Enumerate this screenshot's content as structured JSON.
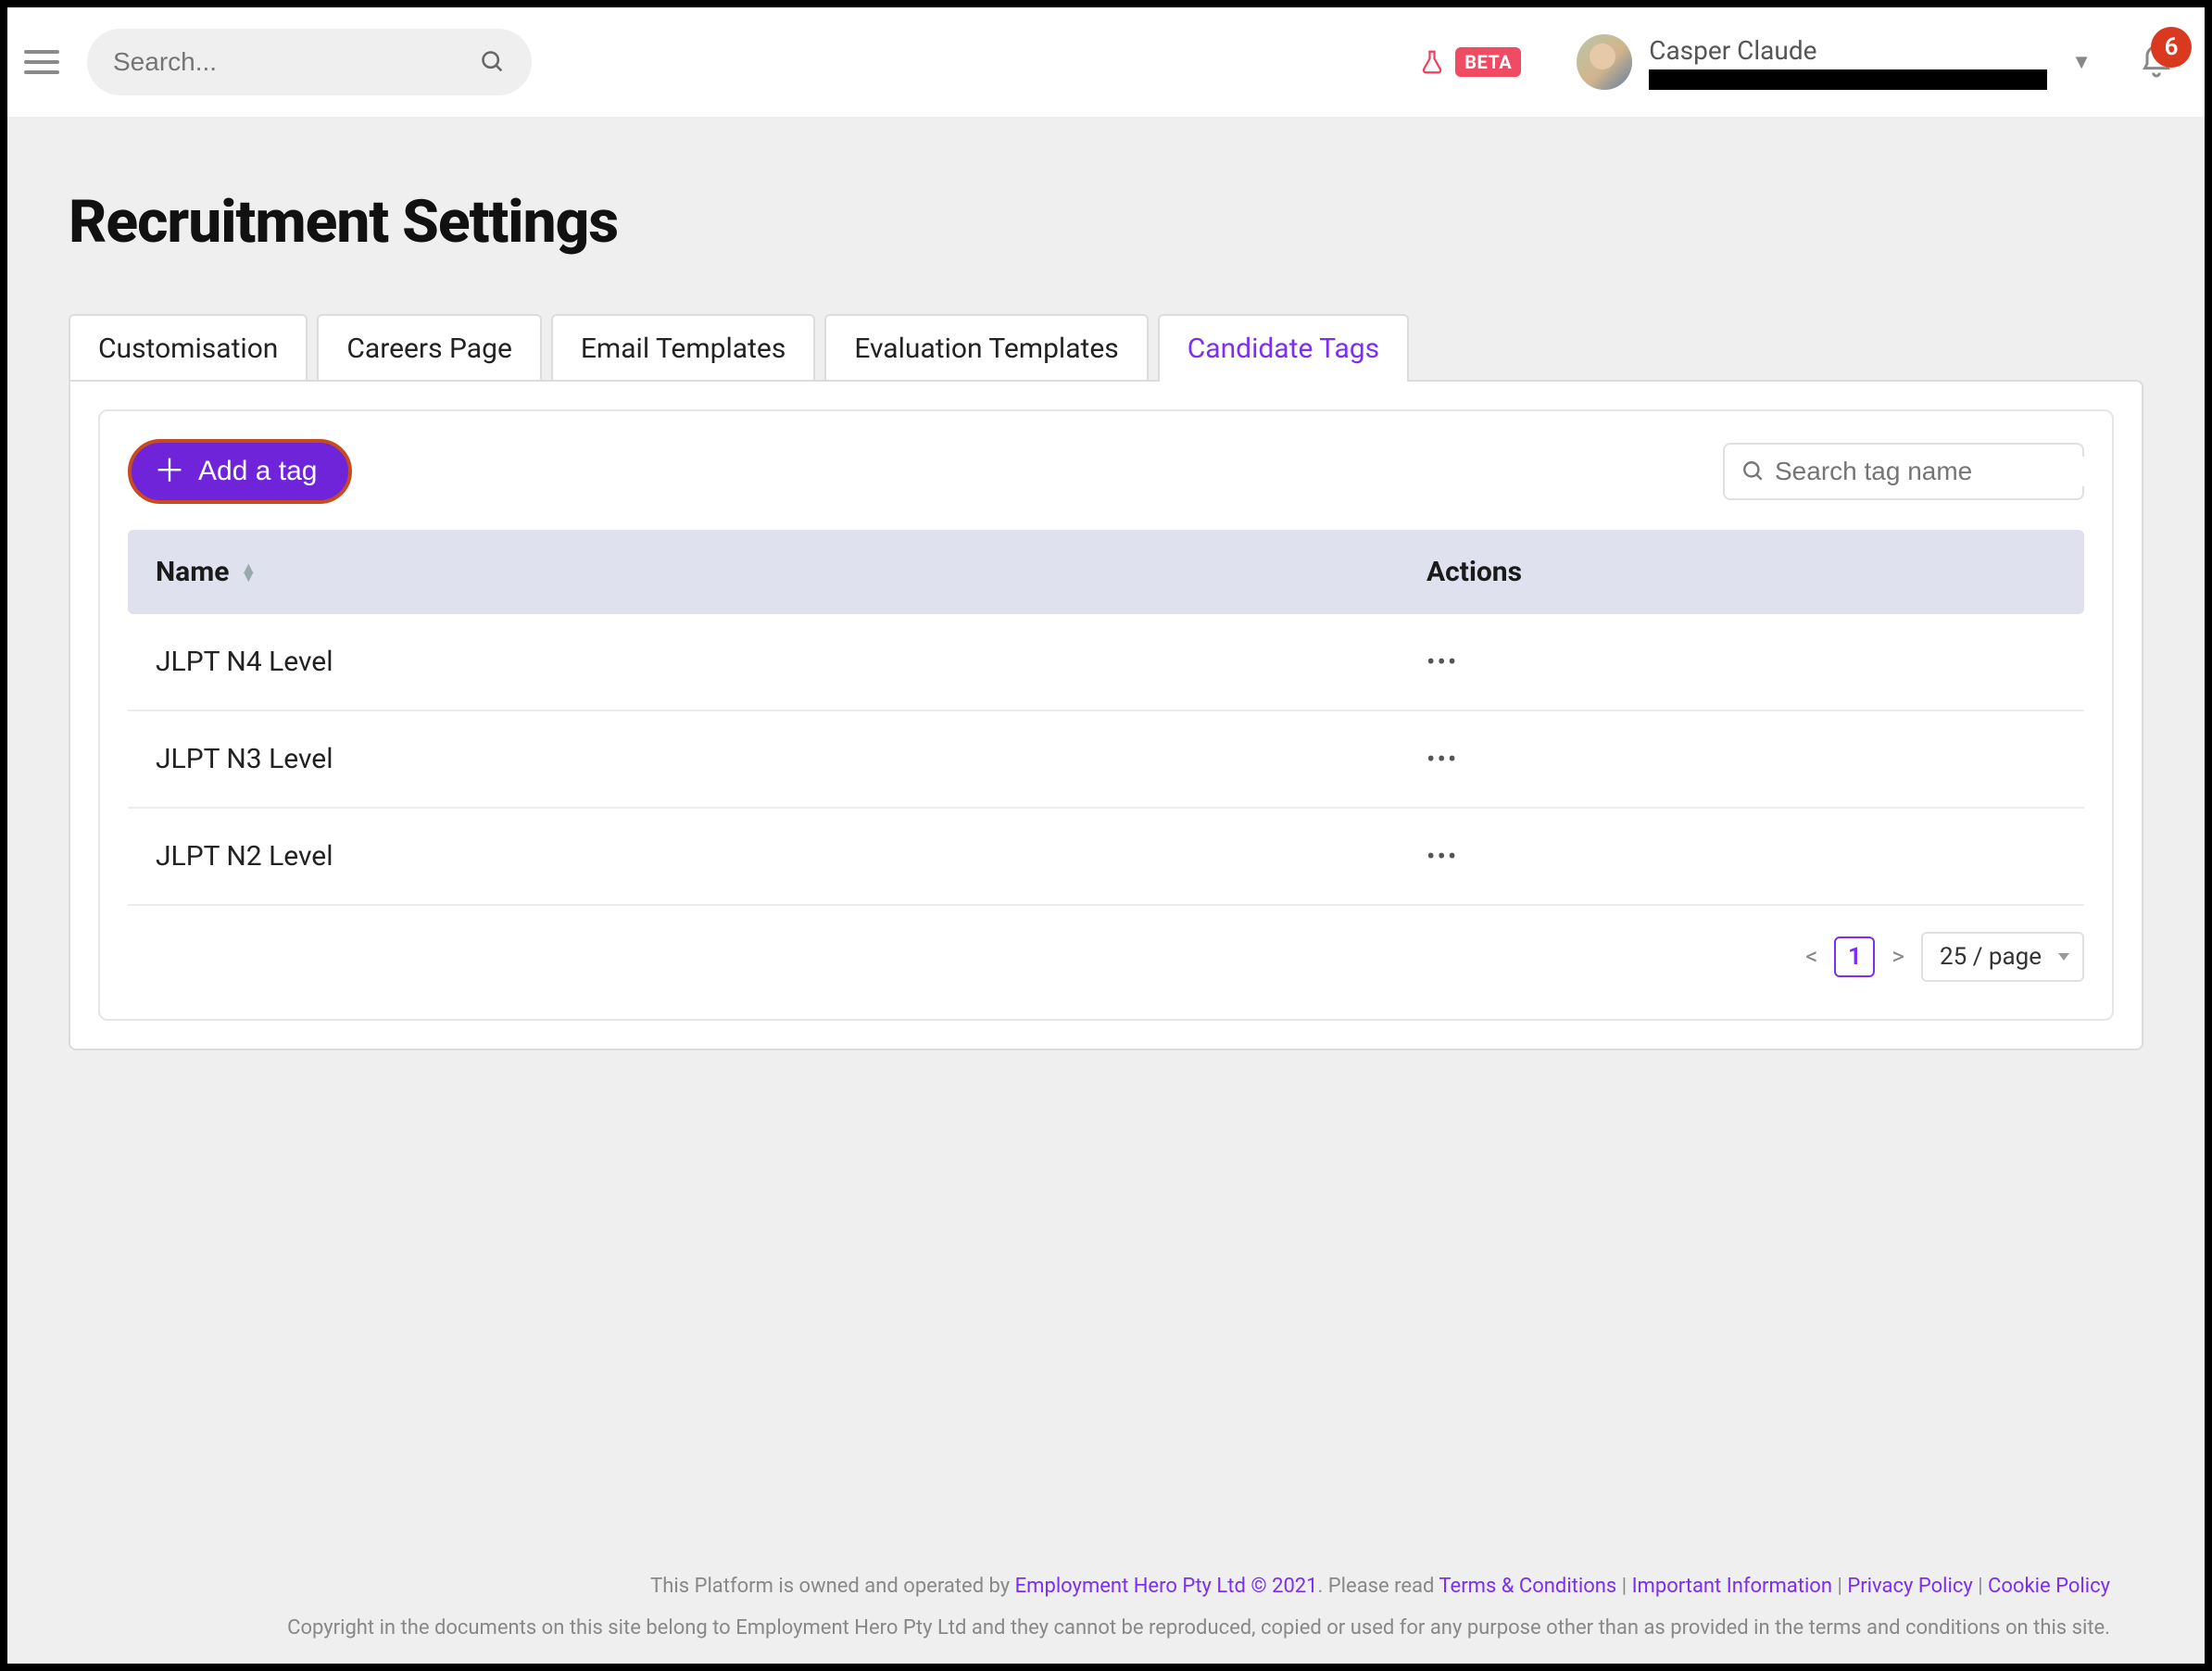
{
  "header": {
    "search_placeholder": "Search...",
    "beta_label": "BETA",
    "user_name": "Casper Claude",
    "notif_count": "6"
  },
  "page": {
    "title": "Recruitment Settings"
  },
  "tabs": [
    {
      "label": "Customisation",
      "active": false
    },
    {
      "label": "Careers Page",
      "active": false
    },
    {
      "label": "Email Templates",
      "active": false
    },
    {
      "label": "Evaluation Templates",
      "active": false
    },
    {
      "label": "Candidate Tags",
      "active": true
    }
  ],
  "panel": {
    "add_button_label": "Add a tag",
    "filter_placeholder": "Search tag name",
    "columns": {
      "name": "Name",
      "actions": "Actions"
    },
    "rows": [
      {
        "name": "JLPT N4 Level"
      },
      {
        "name": "JLPT N3 Level"
      },
      {
        "name": "JLPT N2 Level"
      }
    ],
    "pagination": {
      "current": "1",
      "page_size_label": "25 / page"
    }
  },
  "footer": {
    "pre_owner": "This Platform is owned and operated by ",
    "owner_link": "Employment Hero Pty Ltd © 2021",
    "post_owner": ". Please read ",
    "terms": "Terms & Conditions",
    "important": "Important Information",
    "privacy": "Privacy Policy",
    "cookie": "Cookie Policy",
    "sep": " | ",
    "copyright": "Copyright in the documents on this site belong to Employment Hero Pty Ltd and they cannot be reproduced, copied or used for any purpose other than as provided in the terms and conditions on this site."
  }
}
